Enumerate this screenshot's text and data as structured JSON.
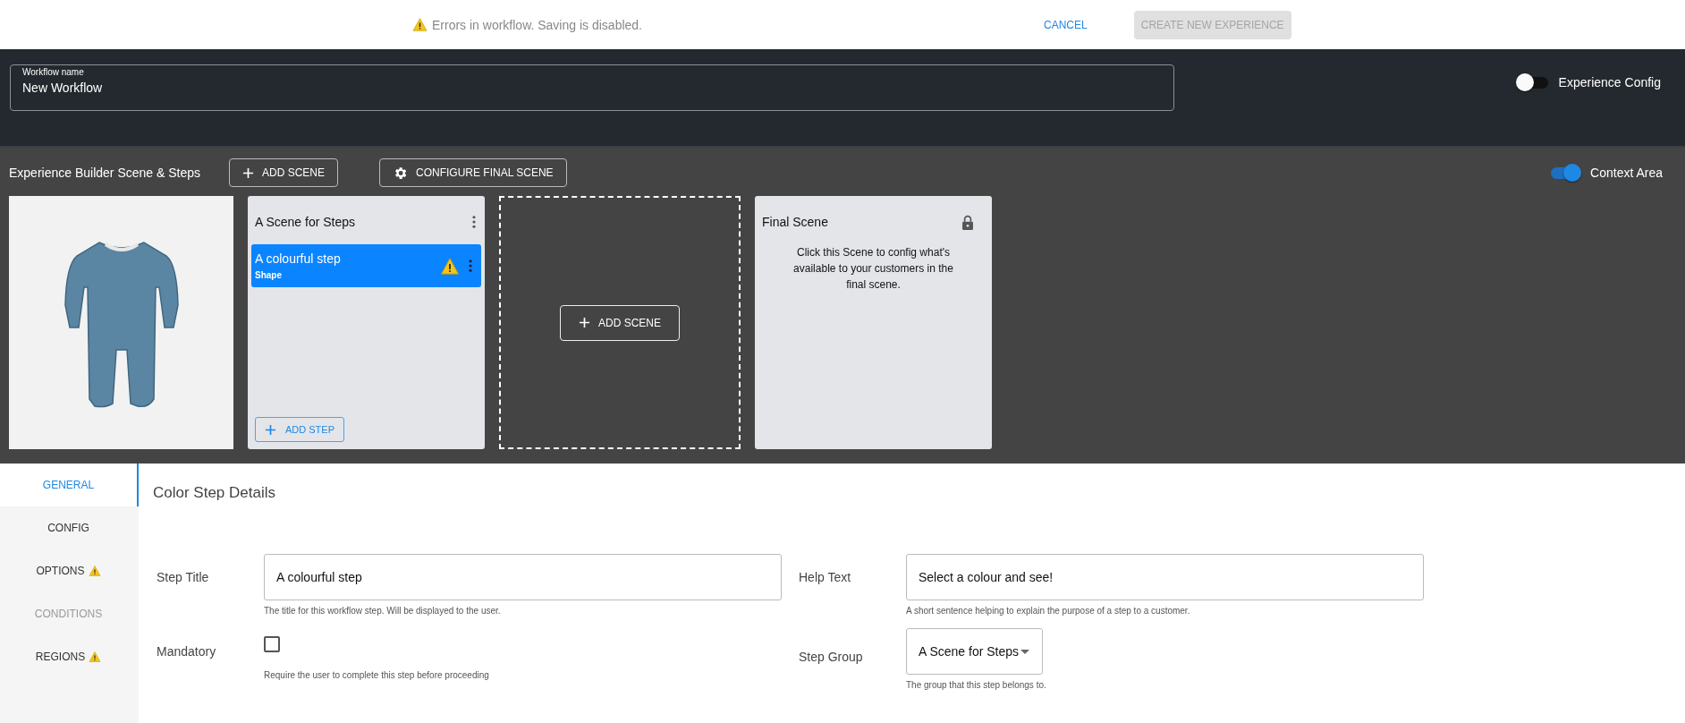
{
  "notice": {
    "text": "Errors in workflow. Saving is disabled.",
    "warning": true
  },
  "actions": [
    {
      "label": "CANCEL",
      "kind": "text",
      "disabled": false
    },
    {
      "label": "CREATE NEW EXPERIENCE",
      "kind": "contained",
      "disabled": true
    }
  ],
  "workflow_name": {
    "label": "Workflow name",
    "value": "New Workflow"
  },
  "experience_config": {
    "label": "Experience Config",
    "on": false
  },
  "builder": {
    "title": "Experience Builder Scene & Steps",
    "buttons": [
      {
        "label": "ADD SCENE",
        "kind": "add"
      },
      {
        "label": "CONFIGURE FINAL SCENE",
        "kind": "configure"
      }
    ],
    "context_area": {
      "label": "Context Area",
      "on": true
    },
    "scenes": [
      {
        "title": "A Scene for Steps",
        "steps": [
          {
            "title": "A colourful step",
            "subtitle": "Shape",
            "warning": true,
            "selected": true
          }
        ],
        "add_step": "ADD STEP"
      }
    ],
    "add_scene": "ADD SCENE",
    "final_scene": {
      "title": "Final Scene",
      "description": "Click this Scene to config what's available to your customers in the final scene.",
      "locked": true
    }
  },
  "tabs": [
    {
      "label": "GENERAL",
      "selected": true,
      "disabled": false,
      "warning": false
    },
    {
      "label": "CONFIG",
      "selected": false,
      "disabled": false,
      "warning": false
    },
    {
      "label": "OPTIONS",
      "selected": false,
      "disabled": false,
      "warning": true
    },
    {
      "label": "CONDITIONS",
      "selected": false,
      "disabled": true,
      "warning": false
    },
    {
      "label": "REGIONS",
      "selected": false,
      "disabled": false,
      "warning": true
    }
  ],
  "details": {
    "title": "Color Step Details",
    "fields": [
      {
        "kind": "text",
        "label": "Step Title",
        "value": "A colourful step",
        "hint": "The title for this workflow step. Will be displayed to the user."
      },
      {
        "kind": "text",
        "label": "Help Text",
        "value": "Select a colour and see!",
        "hint": "A short sentence helping to explain the purpose of a step to a customer."
      },
      {
        "kind": "checkbox",
        "label": "Mandatory",
        "checked": false,
        "hint": "Require the user to complete this step before proceeding"
      },
      {
        "kind": "select",
        "label": "Step Group",
        "value": "A Scene for Steps",
        "hint": "The group that this step belongs to."
      }
    ]
  }
}
